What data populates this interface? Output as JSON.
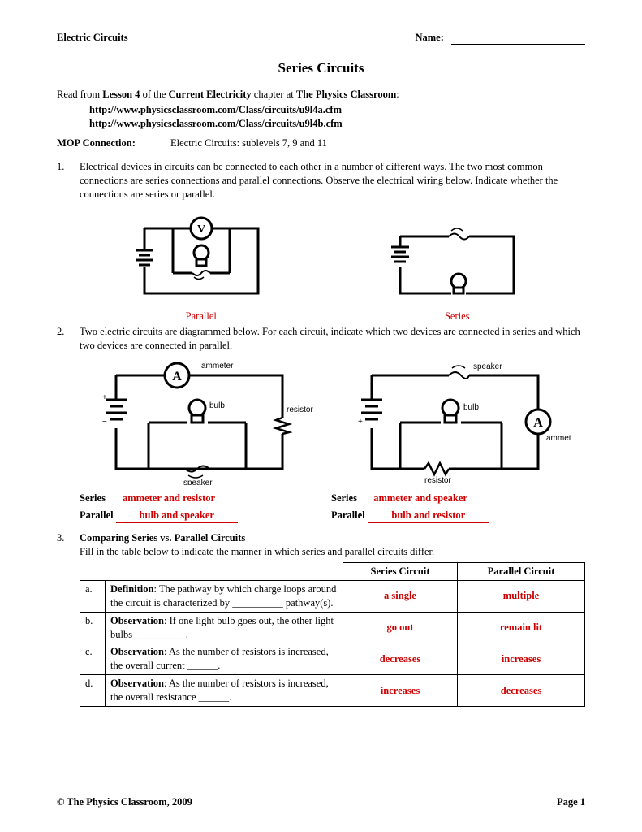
{
  "header": {
    "subject": "Electric Circuits",
    "name_label": "Name:"
  },
  "title": "Series Circuits",
  "intro": {
    "read_prefix": "Read from ",
    "lesson": "Lesson 4",
    "mid": " of the ",
    "chapter": "Current Electricity",
    "suffix": " chapter at ",
    "site": "The Physics Classroom",
    "colon": ":"
  },
  "links": {
    "l1": "http://www.physicsclassroom.com/Class/circuits/u9l4a.cfm",
    "l2": "http://www.physicsclassroom.com/Class/circuits/u9l4b.cfm"
  },
  "mop": {
    "label": "MOP Connection:",
    "text": "Electric Circuits:  sublevels 7, 9 and 11"
  },
  "q1": {
    "num": "1.",
    "text": "Electrical devices in circuits can be connected to each other in a number of different ways.  The two most common connections are series connections and parallel connections.  Observe the electrical wiring below.  Indicate whether the connections are series or parallel.",
    "cap_left": "Parallel",
    "cap_right": "Series"
  },
  "q2": {
    "num": "2.",
    "text": "Two electric circuits are diagrammed below.  For each circuit, indicate which two devices are connected in series and which two devices are connected in parallel.",
    "labels": {
      "ammeter": "ammeter",
      "bulb": "bulb",
      "resistor": "resistor",
      "speaker": "speaker"
    },
    "answers": {
      "left_series_label": "Series",
      "left_series": "ammeter and resistor",
      "left_par_label": "Parallel",
      "left_par": "bulb and speaker",
      "right_series_label": "Series",
      "right_series": "ammeter and speaker",
      "right_par_label": "Parallel",
      "right_par": "bulb and resistor"
    }
  },
  "q3": {
    "num": "3.",
    "heading": "Comparing Series vs. Parallel Circuits",
    "sub": "Fill in the table below to indicate the manner in which series and parallel circuits differ.",
    "col_series": "Series Circuit",
    "col_parallel": "Parallel Circuit",
    "rows": {
      "a": {
        "l": "a.",
        "d1": "Definition",
        "d2": ":  The pathway by which charge loops around the circuit is characterized by __________ pathway(s).",
        "s": "a single",
        "p": "multiple"
      },
      "b": {
        "l": "b.",
        "d1": "Observation",
        "d2": ":  If one light bulb goes out, the other light bulbs __________.",
        "s": "go out",
        "p": "remain lit"
      },
      "c": {
        "l": "c.",
        "d1": "Observation",
        "d2": ":  As the number of resistors is increased, the overall current ______.",
        "s": "decreases",
        "p": "increases"
      },
      "d": {
        "l": "d.",
        "d1": "Observation",
        "d2": ":  As the number of resistors is increased, the overall resistance ______.",
        "s": "increases",
        "p": "decreases"
      }
    }
  },
  "footer": {
    "copy": "©  The Physics Classroom, 2009",
    "page": "Page 1"
  }
}
